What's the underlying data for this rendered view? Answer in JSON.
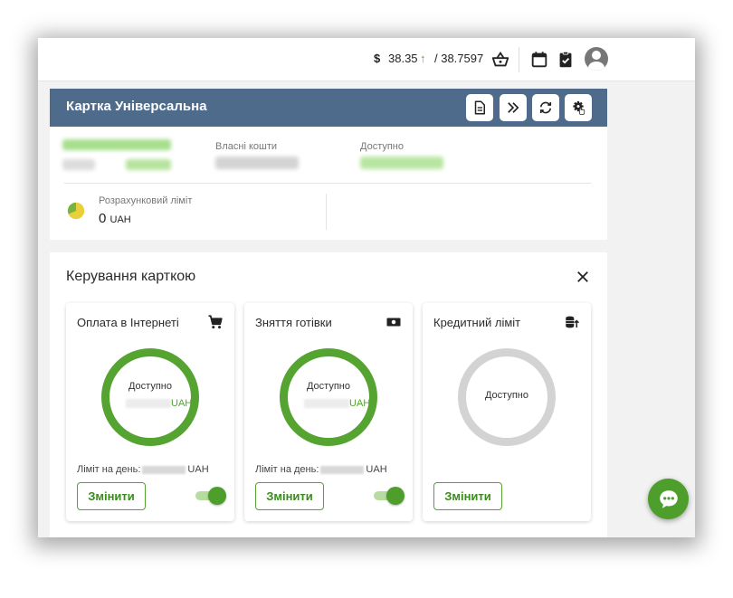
{
  "topbar": {
    "currency_symbol": "$",
    "rate_buy": "38.35",
    "rate_arrow": "↑",
    "rate_sell": "/ 38.7597",
    "icons": [
      "basket-icon",
      "calendar-icon",
      "clipboard-check-icon",
      "user-avatar-icon"
    ]
  },
  "card": {
    "title": "Картка Універсальна",
    "header_buttons": [
      "statement-icon",
      "forward-icon",
      "refresh-icon",
      "gear-icon"
    ],
    "own_funds_label": "Власні кошти",
    "available_label": "Доступно",
    "settlement_limit_label": "Розрахунковий ліміт",
    "settlement_limit_value": "0",
    "settlement_limit_currency": "UAH"
  },
  "management": {
    "title": "Керування карткою",
    "tiles": [
      {
        "title": "Оплата в Інтернеті",
        "icon": "shopping-cart-icon",
        "ring_label": "Доступно",
        "currency": "UAH",
        "day_limit_label": "Ліміт на день:",
        "day_limit_currency": "UAH",
        "button": "Змінити",
        "enabled": true
      },
      {
        "title": "Зняття готівки",
        "icon": "cash-icon",
        "ring_label": "Доступно",
        "currency": "UAH",
        "day_limit_label": "Ліміт на день:",
        "day_limit_currency": "UAH",
        "button": "Змінити",
        "enabled": true
      },
      {
        "title": "Кредитний ліміт",
        "icon": "coins-up-icon",
        "ring_label": "Доступно",
        "button": "Змінити"
      }
    ]
  },
  "colors": {
    "header_bg": "#4e6b8c",
    "accent_green": "#55a331",
    "ring_grey": "#d3d3d3"
  }
}
